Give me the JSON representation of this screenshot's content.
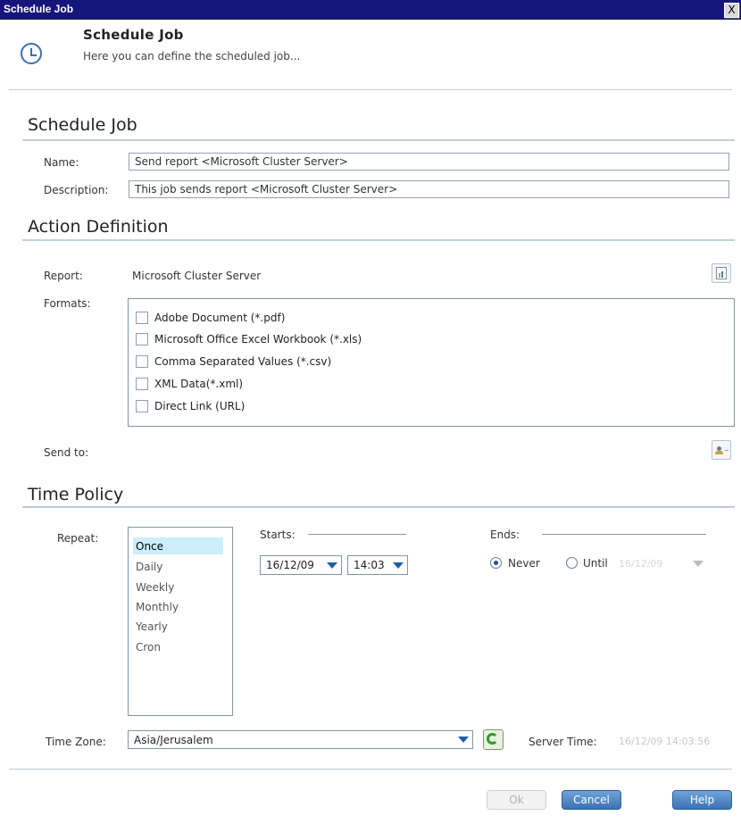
{
  "window": {
    "title": "Schedule Job",
    "close_label": "X"
  },
  "header": {
    "title": "Schedule Job",
    "subtitle": "Here you can define the scheduled job..."
  },
  "schedule_job": {
    "heading": "Schedule Job",
    "name_label": "Name:",
    "name_value": "Send report <Microsoft Cluster Server>",
    "description_label": "Description:",
    "description_value": "This job sends report <Microsoft Cluster Server>"
  },
  "action": {
    "heading": "Action Definition",
    "report_label": "Report:",
    "report_value": "Microsoft Cluster Server",
    "formats_label": "Formats:",
    "formats": [
      {
        "label": "Adobe Document (*.pdf)",
        "checked": false
      },
      {
        "label": "Microsoft Office Excel Workbook (*.xls)",
        "checked": false
      },
      {
        "label": "Comma Separated Values (*.csv)",
        "checked": false
      },
      {
        "label": "XML Data(*.xml)",
        "checked": false
      },
      {
        "label": "Direct Link (URL)",
        "checked": false
      }
    ],
    "send_to_label": "Send to:"
  },
  "time_policy": {
    "heading": "Time Policy",
    "repeat_label": "Repeat:",
    "repeat_options": [
      "Once",
      "Daily",
      "Weekly",
      "Monthly",
      "Yearly",
      "Cron"
    ],
    "repeat_selected": "Once",
    "starts_label": "Starts:",
    "start_date": "16/12/09",
    "start_time": "14:03",
    "ends_label": "Ends:",
    "never_label": "Never",
    "until_label": "Until",
    "until_date": "16/12/09",
    "ends_selected": "Never",
    "timezone_label": "Time Zone:",
    "timezone_value": "Asia/Jerusalem",
    "server_time_label": "Server Time:",
    "server_time_value": "16/12/09 14:03:56"
  },
  "footer": {
    "ok_label": "Ok",
    "cancel_label": "Cancel",
    "help_label": "Help"
  },
  "colors": {
    "titlebar": "#15157a",
    "accent": "#3c72b4",
    "selection": "#cdeefc"
  }
}
